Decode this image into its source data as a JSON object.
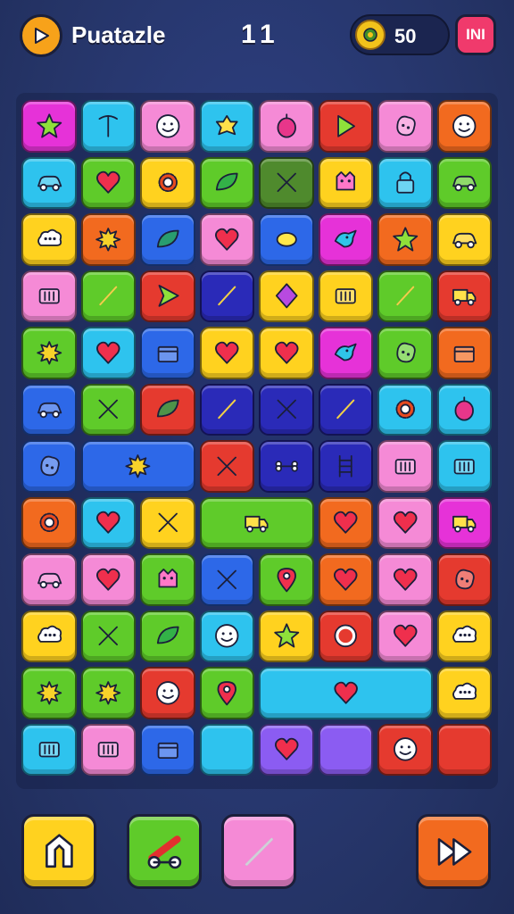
{
  "header": {
    "title": "Puatazle",
    "level": "11",
    "coins": "50",
    "menu_label": "INI"
  },
  "colors": {
    "magenta": "#e632d8",
    "cyan": "#2ec3ee",
    "pink": "#f58ad6",
    "red": "#e53a2f",
    "orange": "#f26a1f",
    "green": "#5fcb2a",
    "yellow": "#ffd21f",
    "blue": "#2d68e8",
    "purple": "#8b5cf2",
    "navy": "#2a2ab8",
    "olive": "#4f8a2d"
  },
  "board": {
    "tiles": [
      {
        "c": "magenta",
        "icon": "star-icon"
      },
      {
        "c": "cyan",
        "icon": "pickaxe-icon"
      },
      {
        "c": "pink",
        "icon": "smiley-icon"
      },
      {
        "c": "cyan",
        "icon": "flower-icon"
      },
      {
        "c": "pink",
        "icon": "fruit-icon"
      },
      {
        "c": "red",
        "icon": "play-icon"
      },
      {
        "c": "pink",
        "icon": "blob-icon"
      },
      {
        "c": "orange",
        "icon": "smiley-icon"
      },
      {
        "c": "cyan",
        "icon": "car-icon"
      },
      {
        "c": "green",
        "icon": "heart-icon"
      },
      {
        "c": "yellow",
        "icon": "gear-icon"
      },
      {
        "c": "green",
        "icon": "leaf-icon"
      },
      {
        "c": "olive",
        "icon": "cross-icon"
      },
      {
        "c": "yellow",
        "icon": "monster-icon"
      },
      {
        "c": "cyan",
        "icon": "lock-icon"
      },
      {
        "c": "green",
        "icon": "car-icon"
      },
      {
        "c": "yellow",
        "icon": "cloud-icon"
      },
      {
        "c": "orange",
        "icon": "splat-icon"
      },
      {
        "c": "blue",
        "icon": "leaf-icon"
      },
      {
        "c": "pink",
        "icon": "heart-icon"
      },
      {
        "c": "blue",
        "icon": "lemon-icon"
      },
      {
        "c": "magenta",
        "icon": "bird-icon"
      },
      {
        "c": "orange",
        "icon": "star-icon"
      },
      {
        "c": "yellow",
        "icon": "car-icon"
      },
      {
        "c": "pink",
        "icon": "battery-icon"
      },
      {
        "c": "green",
        "icon": "brush-icon"
      },
      {
        "c": "red",
        "icon": "arrow-icon"
      },
      {
        "c": "navy",
        "icon": "brush-icon"
      },
      {
        "c": "yellow",
        "icon": "diamond-icon"
      },
      {
        "c": "yellow",
        "icon": "battery-icon"
      },
      {
        "c": "green",
        "icon": "brush-icon"
      },
      {
        "c": "red",
        "icon": "truck-icon"
      },
      {
        "c": "green",
        "icon": "splat-icon"
      },
      {
        "c": "cyan",
        "icon": "heart-icon"
      },
      {
        "c": "blue",
        "icon": "box-icon"
      },
      {
        "c": "yellow",
        "icon": "heart-icon"
      },
      {
        "c": "yellow",
        "icon": "heart-icon"
      },
      {
        "c": "magenta",
        "icon": "bird-icon"
      },
      {
        "c": "green",
        "icon": "blob-icon"
      },
      {
        "c": "orange",
        "icon": "box-icon"
      },
      {
        "c": "blue",
        "icon": "car-icon"
      },
      {
        "c": "green",
        "icon": "cross-icon"
      },
      {
        "c": "red",
        "icon": "leaf-icon"
      },
      {
        "c": "navy",
        "icon": "brush-icon"
      },
      {
        "c": "navy",
        "icon": "cross-icon"
      },
      {
        "c": "navy",
        "icon": "brush-icon"
      },
      {
        "c": "cyan",
        "icon": "gear-icon"
      },
      {
        "c": "cyan",
        "icon": "fruit-icon"
      },
      {
        "c": "blue",
        "icon": "blob-icon"
      },
      {
        "c": "blue",
        "icon": "splat-icon"
      },
      {
        "c": "red",
        "icon": "cross-icon"
      },
      {
        "c": "navy",
        "icon": "bone-icon"
      },
      {
        "c": "navy",
        "icon": "ladder-icon"
      },
      {
        "c": "pink",
        "icon": "battery-icon"
      },
      {
        "c": "cyan",
        "icon": "battery-icon"
      },
      {
        "c": "orange",
        "icon": "gear-icon"
      },
      {
        "c": "cyan",
        "icon": "heart-icon"
      },
      {
        "c": "yellow",
        "icon": "cross-icon"
      },
      {
        "c": "green",
        "icon": "truck-icon"
      },
      {
        "c": "orange",
        "icon": "heart-icon"
      },
      {
        "c": "pink",
        "icon": "heart-icon"
      },
      {
        "c": "magenta",
        "icon": "truck-icon"
      },
      {
        "c": "pink",
        "icon": "car-icon"
      },
      {
        "c": "pink",
        "icon": "heart-icon"
      },
      {
        "c": "green",
        "icon": "monster-icon"
      },
      {
        "c": "blue",
        "icon": "cross-icon"
      },
      {
        "c": "green",
        "icon": "pin-icon"
      },
      {
        "c": "orange",
        "icon": "heart-icon"
      },
      {
        "c": "pink",
        "icon": "heart-icon"
      },
      {
        "c": "red",
        "icon": "blob-icon"
      },
      {
        "c": "yellow",
        "icon": "cloud-icon"
      },
      {
        "c": "green",
        "icon": "cross-icon"
      },
      {
        "c": "green",
        "icon": "leaf-icon"
      },
      {
        "c": "cyan",
        "icon": "smiley-icon"
      },
      {
        "c": "yellow",
        "icon": "star-icon"
      },
      {
        "c": "red",
        "icon": "ring-icon"
      },
      {
        "c": "pink",
        "icon": "heart-icon"
      },
      {
        "c": "yellow",
        "icon": "cloud-icon"
      },
      {
        "c": "green",
        "icon": "splat-icon"
      },
      {
        "c": "green",
        "icon": "splat-icon"
      },
      {
        "c": "red",
        "icon": "smiley-icon"
      },
      {
        "c": "green",
        "icon": "pin-icon"
      },
      {
        "c": "cyan",
        "icon": "heart-icon"
      },
      {
        "c": "yellow",
        "icon": "cloud-icon"
      },
      {
        "c": "cyan",
        "icon": "battery-icon"
      },
      {
        "c": "pink",
        "icon": "battery-icon"
      },
      {
        "c": "blue",
        "icon": "box-icon"
      },
      {
        "c": "cyan",
        "icon": "none"
      },
      {
        "c": "purple",
        "icon": "heart-icon"
      },
      {
        "c": "purple",
        "icon": "none"
      },
      {
        "c": "red",
        "icon": "smiley-icon"
      },
      {
        "c": "red",
        "icon": "none"
      }
    ]
  },
  "footer": {
    "buttons": [
      {
        "name": "hint-button",
        "c": "yellow",
        "icon": "undo-arrow-icon"
      },
      {
        "name": "cannon-button",
        "c": "green",
        "icon": "cannon-icon"
      },
      {
        "name": "tool-button",
        "c": "pink",
        "icon": "wrench-icon"
      },
      {
        "name": "next-button",
        "c": "orange",
        "icon": "forward-icon"
      }
    ]
  }
}
